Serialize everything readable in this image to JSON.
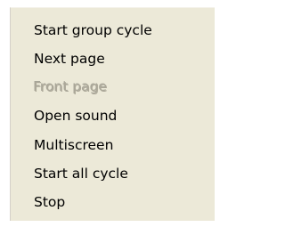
{
  "menu": {
    "items": [
      {
        "label": "Start group cycle",
        "enabled": true
      },
      {
        "label": "Next page",
        "enabled": true
      },
      {
        "label": "Front page",
        "enabled": false
      },
      {
        "label": "Open sound",
        "enabled": true
      },
      {
        "label": "Multiscreen",
        "enabled": true
      },
      {
        "label": "Start all cycle",
        "enabled": true
      },
      {
        "label": "Stop",
        "enabled": true
      }
    ],
    "colors": {
      "background": "#ece9d8",
      "text": "#000000",
      "disabled_text": "#aca899"
    }
  }
}
